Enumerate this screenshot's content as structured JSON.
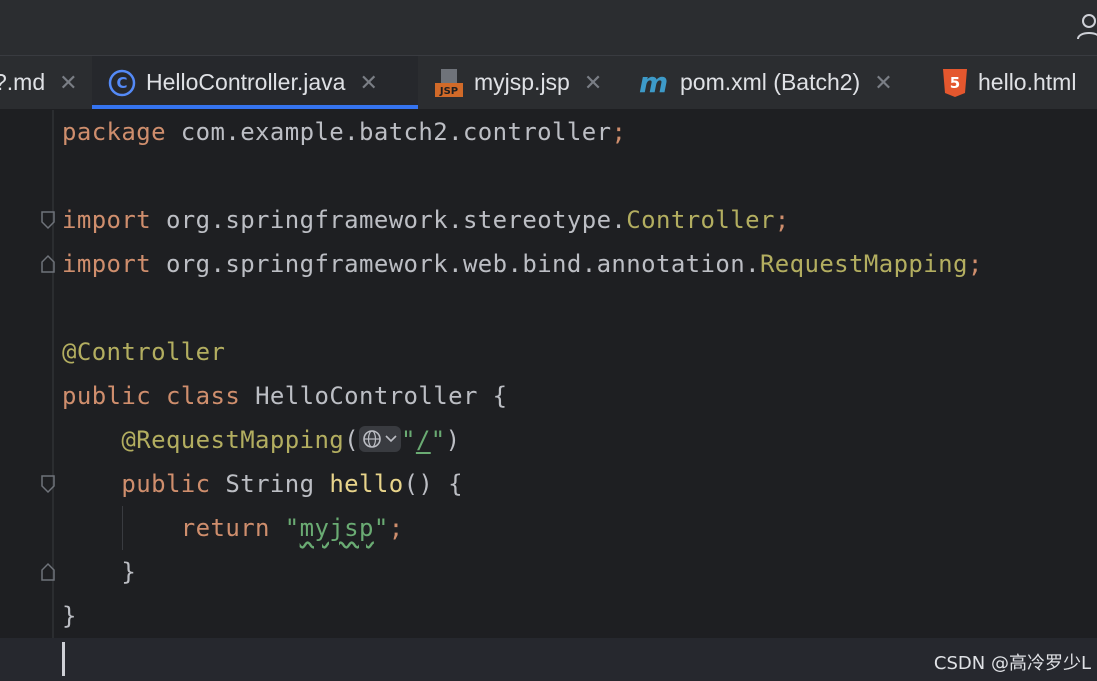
{
  "tabs": [
    {
      "label": "?.md",
      "icon": "markdown-icon",
      "active": false
    },
    {
      "label": "HelloController.java",
      "icon": "java-class-icon",
      "active": true
    },
    {
      "label": "myjsp.jsp",
      "icon": "jsp-file-icon",
      "active": false
    },
    {
      "label": "pom.xml (Batch2)",
      "icon": "maven-icon",
      "active": false
    },
    {
      "label": "hello.html",
      "icon": "html5-icon",
      "active": false
    }
  ],
  "tab_close_glyph": "✕",
  "code": {
    "l1": {
      "kw": "package",
      "rest": " com.example.batch2.controller",
      "semi": ";"
    },
    "l3": {
      "kw": "import",
      "pkg": " org.springframework.stereotype.",
      "cls": "Controller",
      "semi": ";"
    },
    "l4": {
      "kw": "import",
      "pkg": " org.springframework.web.bind.annotation.",
      "cls": "RequestMapping",
      "semi": ";"
    },
    "l6": {
      "ann": "@Controller"
    },
    "l7": {
      "kw1": "public",
      "kw2": "class",
      "name": " HelloController {"
    },
    "l8": {
      "ann": "@RequestMapping",
      "open": "(",
      "q1": "\"",
      "path": "/",
      "q2": "\"",
      "close": ")"
    },
    "l9": {
      "kw": "public",
      "type": " String ",
      "fn": "hello",
      "rest": "() {"
    },
    "l10": {
      "kw": "return",
      "q1": "\"",
      "str": "myjsp",
      "q2": "\"",
      "semi": ";"
    },
    "l11": {
      "text": "}"
    },
    "l12": {
      "text": "}"
    }
  },
  "watermark": "CSDN @高冷罗少L",
  "colors": {
    "accent": "#3574f0",
    "keyword": "#cf8e6d",
    "annotation": "#b3ae60",
    "string": "#6aab73",
    "function": "#e8d48b"
  }
}
